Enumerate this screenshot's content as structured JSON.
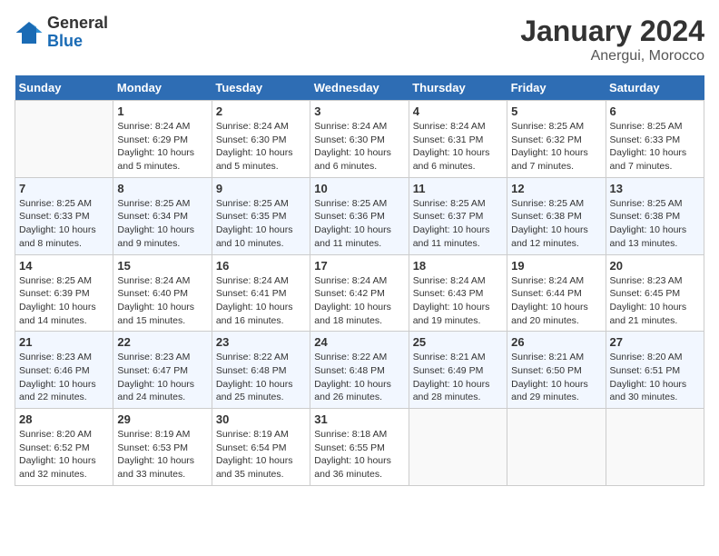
{
  "header": {
    "logo_general": "General",
    "logo_blue": "Blue",
    "month_title": "January 2024",
    "location": "Anergui, Morocco"
  },
  "days_of_week": [
    "Sunday",
    "Monday",
    "Tuesday",
    "Wednesday",
    "Thursday",
    "Friday",
    "Saturday"
  ],
  "weeks": [
    [
      {
        "day": "",
        "sunrise": "",
        "sunset": "",
        "daylight": ""
      },
      {
        "day": "1",
        "sunrise": "Sunrise: 8:24 AM",
        "sunset": "Sunset: 6:29 PM",
        "daylight": "Daylight: 10 hours and 5 minutes."
      },
      {
        "day": "2",
        "sunrise": "Sunrise: 8:24 AM",
        "sunset": "Sunset: 6:30 PM",
        "daylight": "Daylight: 10 hours and 5 minutes."
      },
      {
        "day": "3",
        "sunrise": "Sunrise: 8:24 AM",
        "sunset": "Sunset: 6:30 PM",
        "daylight": "Daylight: 10 hours and 6 minutes."
      },
      {
        "day": "4",
        "sunrise": "Sunrise: 8:24 AM",
        "sunset": "Sunset: 6:31 PM",
        "daylight": "Daylight: 10 hours and 6 minutes."
      },
      {
        "day": "5",
        "sunrise": "Sunrise: 8:25 AM",
        "sunset": "Sunset: 6:32 PM",
        "daylight": "Daylight: 10 hours and 7 minutes."
      },
      {
        "day": "6",
        "sunrise": "Sunrise: 8:25 AM",
        "sunset": "Sunset: 6:33 PM",
        "daylight": "Daylight: 10 hours and 7 minutes."
      }
    ],
    [
      {
        "day": "7",
        "sunrise": "Sunrise: 8:25 AM",
        "sunset": "Sunset: 6:33 PM",
        "daylight": "Daylight: 10 hours and 8 minutes."
      },
      {
        "day": "8",
        "sunrise": "Sunrise: 8:25 AM",
        "sunset": "Sunset: 6:34 PM",
        "daylight": "Daylight: 10 hours and 9 minutes."
      },
      {
        "day": "9",
        "sunrise": "Sunrise: 8:25 AM",
        "sunset": "Sunset: 6:35 PM",
        "daylight": "Daylight: 10 hours and 10 minutes."
      },
      {
        "day": "10",
        "sunrise": "Sunrise: 8:25 AM",
        "sunset": "Sunset: 6:36 PM",
        "daylight": "Daylight: 10 hours and 11 minutes."
      },
      {
        "day": "11",
        "sunrise": "Sunrise: 8:25 AM",
        "sunset": "Sunset: 6:37 PM",
        "daylight": "Daylight: 10 hours and 11 minutes."
      },
      {
        "day": "12",
        "sunrise": "Sunrise: 8:25 AM",
        "sunset": "Sunset: 6:38 PM",
        "daylight": "Daylight: 10 hours and 12 minutes."
      },
      {
        "day": "13",
        "sunrise": "Sunrise: 8:25 AM",
        "sunset": "Sunset: 6:38 PM",
        "daylight": "Daylight: 10 hours and 13 minutes."
      }
    ],
    [
      {
        "day": "14",
        "sunrise": "Sunrise: 8:25 AM",
        "sunset": "Sunset: 6:39 PM",
        "daylight": "Daylight: 10 hours and 14 minutes."
      },
      {
        "day": "15",
        "sunrise": "Sunrise: 8:24 AM",
        "sunset": "Sunset: 6:40 PM",
        "daylight": "Daylight: 10 hours and 15 minutes."
      },
      {
        "day": "16",
        "sunrise": "Sunrise: 8:24 AM",
        "sunset": "Sunset: 6:41 PM",
        "daylight": "Daylight: 10 hours and 16 minutes."
      },
      {
        "day": "17",
        "sunrise": "Sunrise: 8:24 AM",
        "sunset": "Sunset: 6:42 PM",
        "daylight": "Daylight: 10 hours and 18 minutes."
      },
      {
        "day": "18",
        "sunrise": "Sunrise: 8:24 AM",
        "sunset": "Sunset: 6:43 PM",
        "daylight": "Daylight: 10 hours and 19 minutes."
      },
      {
        "day": "19",
        "sunrise": "Sunrise: 8:24 AM",
        "sunset": "Sunset: 6:44 PM",
        "daylight": "Daylight: 10 hours and 20 minutes."
      },
      {
        "day": "20",
        "sunrise": "Sunrise: 8:23 AM",
        "sunset": "Sunset: 6:45 PM",
        "daylight": "Daylight: 10 hours and 21 minutes."
      }
    ],
    [
      {
        "day": "21",
        "sunrise": "Sunrise: 8:23 AM",
        "sunset": "Sunset: 6:46 PM",
        "daylight": "Daylight: 10 hours and 22 minutes."
      },
      {
        "day": "22",
        "sunrise": "Sunrise: 8:23 AM",
        "sunset": "Sunset: 6:47 PM",
        "daylight": "Daylight: 10 hours and 24 minutes."
      },
      {
        "day": "23",
        "sunrise": "Sunrise: 8:22 AM",
        "sunset": "Sunset: 6:48 PM",
        "daylight": "Daylight: 10 hours and 25 minutes."
      },
      {
        "day": "24",
        "sunrise": "Sunrise: 8:22 AM",
        "sunset": "Sunset: 6:48 PM",
        "daylight": "Daylight: 10 hours and 26 minutes."
      },
      {
        "day": "25",
        "sunrise": "Sunrise: 8:21 AM",
        "sunset": "Sunset: 6:49 PM",
        "daylight": "Daylight: 10 hours and 28 minutes."
      },
      {
        "day": "26",
        "sunrise": "Sunrise: 8:21 AM",
        "sunset": "Sunset: 6:50 PM",
        "daylight": "Daylight: 10 hours and 29 minutes."
      },
      {
        "day": "27",
        "sunrise": "Sunrise: 8:20 AM",
        "sunset": "Sunset: 6:51 PM",
        "daylight": "Daylight: 10 hours and 30 minutes."
      }
    ],
    [
      {
        "day": "28",
        "sunrise": "Sunrise: 8:20 AM",
        "sunset": "Sunset: 6:52 PM",
        "daylight": "Daylight: 10 hours and 32 minutes."
      },
      {
        "day": "29",
        "sunrise": "Sunrise: 8:19 AM",
        "sunset": "Sunset: 6:53 PM",
        "daylight": "Daylight: 10 hours and 33 minutes."
      },
      {
        "day": "30",
        "sunrise": "Sunrise: 8:19 AM",
        "sunset": "Sunset: 6:54 PM",
        "daylight": "Daylight: 10 hours and 35 minutes."
      },
      {
        "day": "31",
        "sunrise": "Sunrise: 8:18 AM",
        "sunset": "Sunset: 6:55 PM",
        "daylight": "Daylight: 10 hours and 36 minutes."
      },
      {
        "day": "",
        "sunrise": "",
        "sunset": "",
        "daylight": ""
      },
      {
        "day": "",
        "sunrise": "",
        "sunset": "",
        "daylight": ""
      },
      {
        "day": "",
        "sunrise": "",
        "sunset": "",
        "daylight": ""
      }
    ]
  ]
}
